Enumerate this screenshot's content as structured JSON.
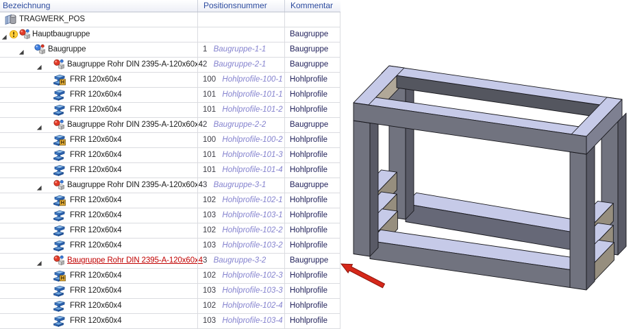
{
  "tree": {
    "columns": [
      "Bezeichnung",
      "Positionsnummer",
      "Kommentar"
    ],
    "rows": [
      {
        "depth": 0,
        "expander": false,
        "warning": false,
        "icon": "parts-library-icon",
        "name": "TRAGWERK_POS",
        "red": false,
        "pos": "",
        "inst": "",
        "comment": ""
      },
      {
        "depth": 1,
        "expander": true,
        "warning": true,
        "icon": "assembly-red-icon",
        "name": "Hauptbaugruppe",
        "red": false,
        "pos": "",
        "inst": "",
        "comment": "Baugruppe"
      },
      {
        "depth": 2,
        "expander": true,
        "warning": false,
        "icon": "assembly-blue-icon",
        "name": "Baugruppe",
        "red": false,
        "pos": "1",
        "inst": "Baugruppe-1-1",
        "comment": "Baugruppe"
      },
      {
        "depth": 3,
        "expander": true,
        "warning": false,
        "icon": "assembly-red-icon",
        "name": "Baugruppe Rohr DIN 2395-A-120x60x4",
        "red": false,
        "pos": "2",
        "inst": "Baugruppe-2-1",
        "comment": "Baugruppe"
      },
      {
        "depth": 4,
        "expander": false,
        "warning": false,
        "icon": "beam-profile-h-icon",
        "name": "FRR 120x60x4",
        "red": false,
        "pos": "100",
        "inst": "Hohlprofile-100-1",
        "comment": "Hohlprofile"
      },
      {
        "depth": 4,
        "expander": false,
        "warning": false,
        "icon": "beam-profile-icon",
        "name": "FRR 120x60x4",
        "red": false,
        "pos": "101",
        "inst": "Hohlprofile-101-1",
        "comment": "Hohlprofile"
      },
      {
        "depth": 4,
        "expander": false,
        "warning": false,
        "icon": "beam-profile-icon",
        "name": "FRR 120x60x4",
        "red": false,
        "pos": "101",
        "inst": "Hohlprofile-101-2",
        "comment": "Hohlprofile"
      },
      {
        "depth": 3,
        "expander": true,
        "warning": false,
        "icon": "assembly-red-icon",
        "name": "Baugruppe Rohr DIN 2395-A-120x60x4",
        "red": false,
        "pos": "2",
        "inst": "Baugruppe-2-2",
        "comment": "Baugruppe"
      },
      {
        "depth": 4,
        "expander": false,
        "warning": false,
        "icon": "beam-profile-h-icon",
        "name": "FRR 120x60x4",
        "red": false,
        "pos": "100",
        "inst": "Hohlprofile-100-2",
        "comment": "Hohlprofile"
      },
      {
        "depth": 4,
        "expander": false,
        "warning": false,
        "icon": "beam-profile-icon",
        "name": "FRR 120x60x4",
        "red": false,
        "pos": "101",
        "inst": "Hohlprofile-101-3",
        "comment": "Hohlprofile"
      },
      {
        "depth": 4,
        "expander": false,
        "warning": false,
        "icon": "beam-profile-icon",
        "name": "FRR 120x60x4",
        "red": false,
        "pos": "101",
        "inst": "Hohlprofile-101-4",
        "comment": "Hohlprofile"
      },
      {
        "depth": 3,
        "expander": true,
        "warning": false,
        "icon": "assembly-red-icon",
        "name": "Baugruppe Rohr DIN 2395-A-120x60x4",
        "red": false,
        "pos": "3",
        "inst": "Baugruppe-3-1",
        "comment": "Baugruppe"
      },
      {
        "depth": 4,
        "expander": false,
        "warning": false,
        "icon": "beam-profile-h-icon",
        "name": "FRR 120x60x4",
        "red": false,
        "pos": "102",
        "inst": "Hohlprofile-102-1",
        "comment": "Hohlprofile"
      },
      {
        "depth": 4,
        "expander": false,
        "warning": false,
        "icon": "beam-profile-icon",
        "name": "FRR 120x60x4",
        "red": false,
        "pos": "103",
        "inst": "Hohlprofile-103-1",
        "comment": "Hohlprofile"
      },
      {
        "depth": 4,
        "expander": false,
        "warning": false,
        "icon": "beam-profile-icon",
        "name": "FRR 120x60x4",
        "red": false,
        "pos": "102",
        "inst": "Hohlprofile-102-2",
        "comment": "Hohlprofile"
      },
      {
        "depth": 4,
        "expander": false,
        "warning": false,
        "icon": "beam-profile-icon",
        "name": "FRR 120x60x4",
        "red": false,
        "pos": "103",
        "inst": "Hohlprofile-103-2",
        "comment": "Hohlprofile"
      },
      {
        "depth": 3,
        "expander": true,
        "warning": false,
        "icon": "assembly-red-icon",
        "name": "Baugruppe Rohr DIN 2395-A-120x60x4",
        "red": true,
        "pos": "3",
        "inst": "Baugruppe-3-2",
        "comment": "Baugruppe"
      },
      {
        "depth": 4,
        "expander": false,
        "warning": false,
        "icon": "beam-profile-h-icon",
        "name": "FRR 120x60x4",
        "red": false,
        "pos": "102",
        "inst": "Hohlprofile-102-3",
        "comment": "Hohlprofile"
      },
      {
        "depth": 4,
        "expander": false,
        "warning": false,
        "icon": "beam-profile-icon",
        "name": "FRR 120x60x4",
        "red": false,
        "pos": "103",
        "inst": "Hohlprofile-103-3",
        "comment": "Hohlprofile"
      },
      {
        "depth": 4,
        "expander": false,
        "warning": false,
        "icon": "beam-profile-icon",
        "name": "FRR 120x60x4",
        "red": false,
        "pos": "102",
        "inst": "Hohlprofile-102-4",
        "comment": "Hohlprofile"
      },
      {
        "depth": 4,
        "expander": false,
        "warning": false,
        "icon": "beam-profile-icon",
        "name": "FRR 120x60x4",
        "red": false,
        "pos": "103",
        "inst": "Hohlprofile-103-4",
        "comment": "Hohlprofile"
      }
    ]
  },
  "colors": {
    "header_text": "#2b4a9e",
    "name_text": "#1a1a1a",
    "red_highlight": "#c00000",
    "position_number": "#3c3c46",
    "instance_name": "#8583cf",
    "comment_text": "#23235c",
    "grid_line": "#dadbe0",
    "frame_top_face": "#c6cae8",
    "frame_front_face": "#71737f",
    "frame_side_face": "#595a66",
    "frame_dark_face": "#4a4c55",
    "frame_tan_face": "#b1a898",
    "arrow_red": "#d6281a"
  }
}
